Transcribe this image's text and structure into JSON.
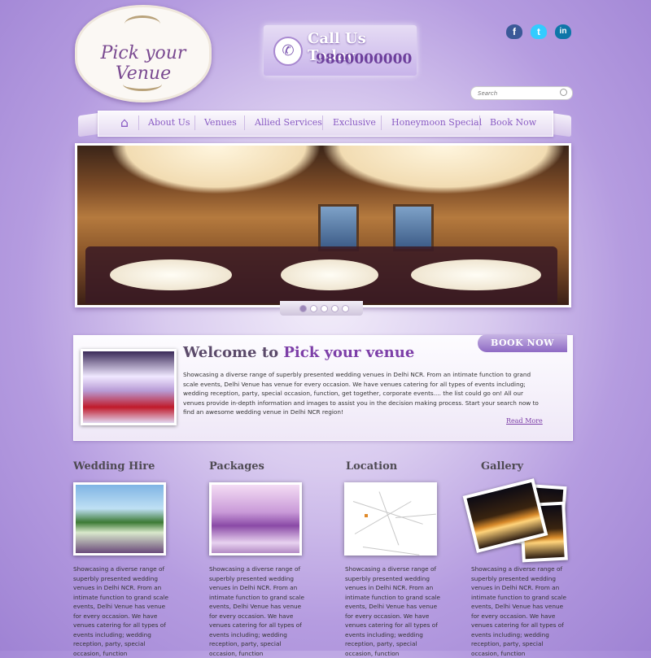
{
  "logo": {
    "text": "Pick your Venue"
  },
  "call": {
    "label": "Call Us Today",
    "number": "9800000000"
  },
  "social": [
    {
      "name": "facebook",
      "glyph": "f",
      "color": "#3b5998"
    },
    {
      "name": "twitter",
      "glyph": "t",
      "color": "#33ccff"
    },
    {
      "name": "linkedin",
      "glyph": "in",
      "color": "#0e76a8"
    }
  ],
  "search": {
    "placeholder": "Search"
  },
  "nav": {
    "home_icon": "home-icon",
    "items": [
      "About Us",
      "Venues",
      "Allied Services",
      "Exclusive",
      "Honeymoon Special",
      "Book Now"
    ]
  },
  "slider": {
    "dots": 5,
    "active": 1
  },
  "welcome": {
    "title_prefix": "Welcome to",
    "title_accent": "Pick your venue",
    "body": "Showcasing a diverse range of superbly presented wedding venues in Delhi NCR. From an intimate function to grand scale events, Delhi Venue has venue for every occasion. We have venues catering for all types of events including; wedding reception, party, special occasion, function, get together, corporate events.... the list could go on! All our venues provide in-depth information and images to assist you in the decision making process. Start your search now to find an awesome wedding venue in Delhi NCR region!",
    "read_more": "Read More",
    "book_now": "BOOK NOW"
  },
  "columns": [
    {
      "title": "Wedding Hire",
      "text": "Showcasing a diverse range of superbly presented wedding venues in Delhi NCR. From an intimate function to grand scale events, Delhi Venue has venue for every occasion. We have venues catering for all types of events including; wedding reception, party, special occasion, function"
    },
    {
      "title": "Packages",
      "text": "Showcasing a diverse range of superbly presented wedding venues in Delhi NCR. From an intimate function to grand scale events, Delhi Venue has venue for every occasion. We have venues catering for all types of events including; wedding reception, party, special occasion, function"
    },
    {
      "title": "Location",
      "text": "Showcasing a diverse range of superbly presented wedding venues in Delhi NCR. From an intimate function to grand scale events, Delhi Venue has venue for every occasion. We have venues catering for all types of events including; wedding reception, party, special occasion, function"
    },
    {
      "title": "Gallery",
      "text": "Showcasing a diverse range of superbly presented wedding venues in Delhi NCR. From an intimate function to grand scale events, Delhi Venue has venue for every occasion. We have venues catering for all types of events including; wedding reception, party, special occasion, function"
    }
  ]
}
